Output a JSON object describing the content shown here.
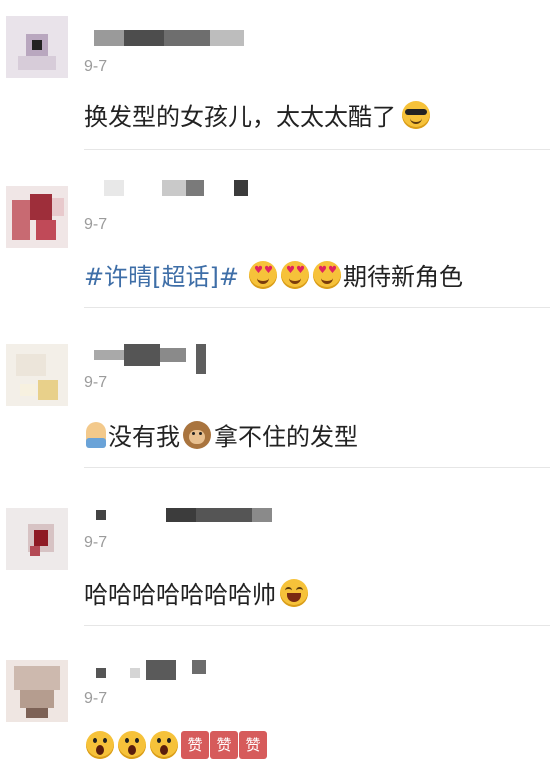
{
  "comments": [
    {
      "date": "9-7",
      "text": "换发型的女孩儿，太太太酷了",
      "emoji": "sunglasses-emoji"
    },
    {
      "date": "9-7",
      "topic": "#许晴[超话]#",
      "emojis": [
        "heart-eyes-emoji",
        "heart-eyes-emoji",
        "heart-eyes-emoji"
      ],
      "text": "期待新角色"
    },
    {
      "date": "9-7",
      "prefix_emoji": "person-emoji",
      "text_a": "没有我",
      "mid_emoji": "monkey-emoji",
      "text_b": "拿不住的发型"
    },
    {
      "date": "9-7",
      "text": "哈哈哈哈哈哈哈帅",
      "emoji": "laughing-emoji"
    },
    {
      "date": "9-7",
      "emojis": [
        "screaming-emoji",
        "screaming-emoji",
        "screaming-emoji"
      ],
      "zan": [
        "赞",
        "赞",
        "赞"
      ]
    }
  ],
  "colors": {
    "topic": "#3e6ea7",
    "date": "#9b9b9b",
    "divider": "#e6e6e6"
  }
}
